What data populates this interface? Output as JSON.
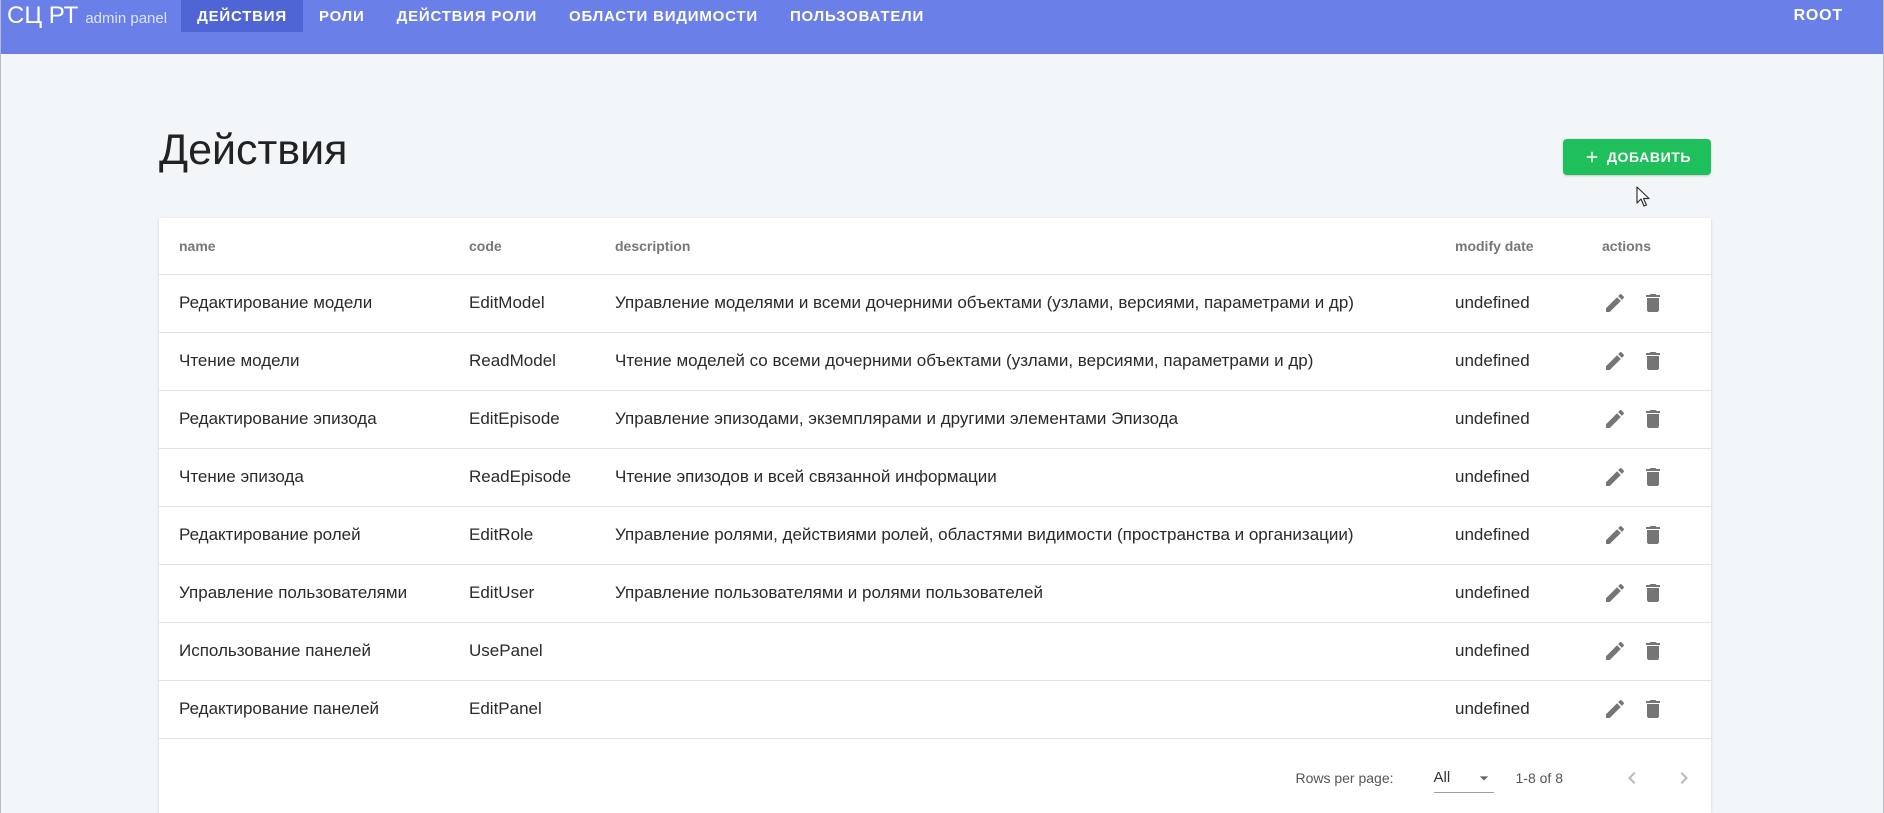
{
  "brand": {
    "title": "СЦ РТ",
    "subtitle": "admin panel"
  },
  "nav": {
    "items": [
      {
        "label": "ДЕЙСТВИЯ",
        "active": true
      },
      {
        "label": "РОЛИ",
        "active": false
      },
      {
        "label": "ДЕЙСТВИЯ РОЛИ",
        "active": false
      },
      {
        "label": "ОБЛАСТИ ВИДИМОСТИ",
        "active": false
      },
      {
        "label": "ПОЛЬЗОВАТЕЛИ",
        "active": false
      }
    ],
    "user": "ROOT"
  },
  "page": {
    "title": "Действия",
    "add_label": "ДОБАВИТЬ"
  },
  "table": {
    "columns": {
      "name": "name",
      "code": "code",
      "description": "description",
      "modify_date": "modify date",
      "actions": "actions"
    },
    "rows": [
      {
        "name": "Редактирование модели",
        "code": "EditModel",
        "description": "Управление моделями и всеми дочерними объектами (узлами, версиями, параметрами и др)",
        "modify_date": "undefined"
      },
      {
        "name": "Чтение модели",
        "code": "ReadModel",
        "description": "Чтение моделей со всеми дочерними объектами (узлами, версиями, параметрами и др)",
        "modify_date": "undefined"
      },
      {
        "name": "Редактирование эпизода",
        "code": "EditEpisode",
        "description": "Управление эпизодами, экземплярами и другими элементами Эпизода",
        "modify_date": "undefined"
      },
      {
        "name": "Чтение эпизода",
        "code": "ReadEpisode",
        "description": "Чтение эпизодов и всей связанной информации",
        "modify_date": "undefined"
      },
      {
        "name": "Редактирование ролей",
        "code": "EditRole",
        "description": "Управление ролями, действиями ролей, областями видимости (пространства и организации)",
        "modify_date": "undefined"
      },
      {
        "name": "Управление пользователями",
        "code": "EditUser",
        "description": "Управление пользователями и ролями пользователей",
        "modify_date": "undefined"
      },
      {
        "name": "Использование панелей",
        "code": "UsePanel",
        "description": "",
        "modify_date": "undefined"
      },
      {
        "name": "Редактирование панелей",
        "code": "EditPanel",
        "description": "",
        "modify_date": "undefined"
      }
    ]
  },
  "pagination": {
    "rows_per_page_label": "Rows per page:",
    "rows_per_page_value": "All",
    "range": "1-8 of 8"
  },
  "colors": {
    "topbar": "#6a7fe8",
    "nav_active": "#4f65d6",
    "add_button": "#1fbf5b",
    "icon": "#757575"
  }
}
